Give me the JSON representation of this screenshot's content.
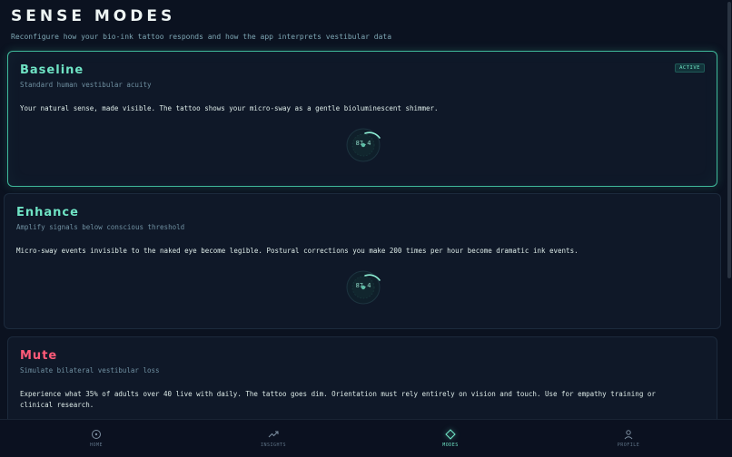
{
  "header": {
    "title": "SENSE MODES",
    "subtitle": "Reconfigure how your bio-ink tattoo responds and how the app interprets vestibular data"
  },
  "modes": [
    {
      "title": "Baseline",
      "subtitle": "Standard human vestibular acuity",
      "description": "Your natural sense, made visible. The tattoo shows your micro-sway as a gentle bioluminescent shimmer.",
      "badge": "ACTIVE",
      "dial_value": "87.4",
      "active": true
    },
    {
      "title": "Enhance",
      "subtitle": "Amplify signals below conscious threshold",
      "description": "Micro-sway events invisible to the naked eye become legible. Postural corrections you make 200 times per hour become dramatic ink events.",
      "dial_value": "87.4",
      "active": false
    },
    {
      "title": "Mute",
      "subtitle": "Simulate bilateral vestibular loss",
      "description": "Experience what 35% of adults over 40 live with daily. The tattoo goes dim. Orientation must rely entirely on vision and touch. Use for empathy training or clinical research.",
      "active": false
    }
  ],
  "nav": {
    "items": [
      {
        "label": "HOME",
        "icon": "compass-icon"
      },
      {
        "label": "INSIGHTS",
        "icon": "trend-icon"
      },
      {
        "label": "MODES",
        "icon": "diamond-icon",
        "active": true
      },
      {
        "label": "PROFILE",
        "icon": "user-icon"
      }
    ]
  },
  "colors": {
    "accent": "#6fe3c4",
    "danger": "#ff5a78",
    "background": "#0b1220"
  }
}
